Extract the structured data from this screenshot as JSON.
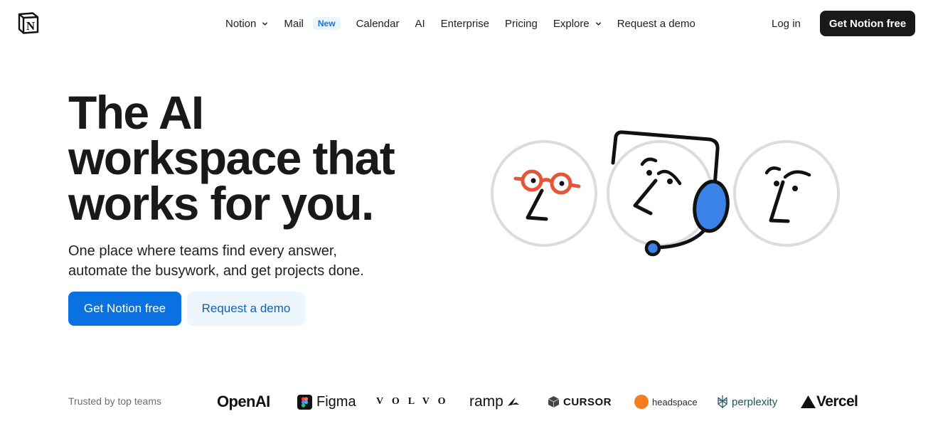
{
  "nav": {
    "logo_letter": "N",
    "items": [
      {
        "label": "Notion",
        "has_dropdown": true
      },
      {
        "label": "Mail",
        "badge": "New"
      },
      {
        "label": "Calendar"
      },
      {
        "label": "AI"
      },
      {
        "label": "Enterprise"
      },
      {
        "label": "Pricing"
      },
      {
        "label": "Explore",
        "has_dropdown": true
      },
      {
        "label": "Request a demo"
      }
    ],
    "login_label": "Log in",
    "cta_label": "Get Notion free"
  },
  "hero": {
    "headline_lines": [
      "The AI",
      "workspace that",
      "works for you."
    ],
    "subhead_lines": [
      "One place where teams find every answer,",
      "automate the busywork, and get projects done."
    ],
    "primary_cta": "Get Notion free",
    "secondary_cta": "Request a demo"
  },
  "trusted": {
    "label": "Trusted by top teams",
    "logos": [
      "OpenAI",
      "Figma",
      "VOLVO",
      "ramp",
      "CURSOR",
      "headspace",
      "perplexity",
      "Vercel"
    ]
  },
  "colors": {
    "primary_blue": "#0a72e0",
    "secondary_bg": "#eef6fd",
    "dark": "#191918",
    "glasses_red": "#e4553a",
    "headset_blue": "#3b82e8"
  },
  "icons": {
    "logo": "notion-logo-icon",
    "dropdown": "chevron-down-icon"
  }
}
